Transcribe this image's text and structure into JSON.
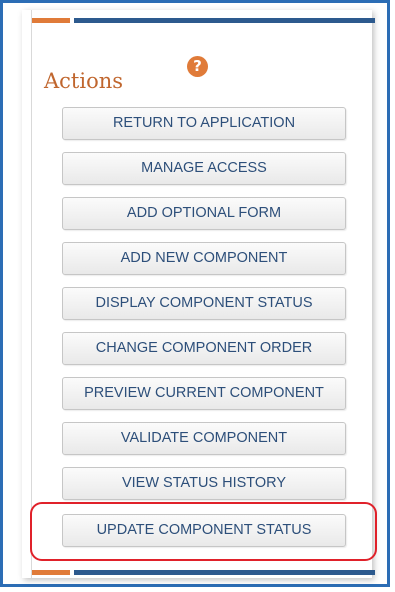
{
  "panel": {
    "title": "Actions",
    "help_icon": "question-mark-icon",
    "help_glyph": "?"
  },
  "actions": [
    {
      "label": "RETURN TO APPLICATION"
    },
    {
      "label": "MANAGE ACCESS"
    },
    {
      "label": "ADD OPTIONAL FORM"
    },
    {
      "label": "ADD NEW COMPONENT"
    },
    {
      "label": "DISPLAY COMPONENT STATUS"
    },
    {
      "label": "CHANGE COMPONENT ORDER"
    },
    {
      "label": "PREVIEW CURRENT COMPONENT"
    },
    {
      "label": "VALIDATE COMPONENT"
    },
    {
      "label": "VIEW STATUS HISTORY"
    },
    {
      "label": "UPDATE COMPONENT STATUS",
      "highlighted": true
    }
  ],
  "colors": {
    "frame_border": "#2c6db5",
    "accent_orange": "#e07b39",
    "accent_blue": "#2d5a8e",
    "title_color": "#c0662e",
    "button_text": "#2d4f7a",
    "highlight_ring": "#e0212a"
  }
}
